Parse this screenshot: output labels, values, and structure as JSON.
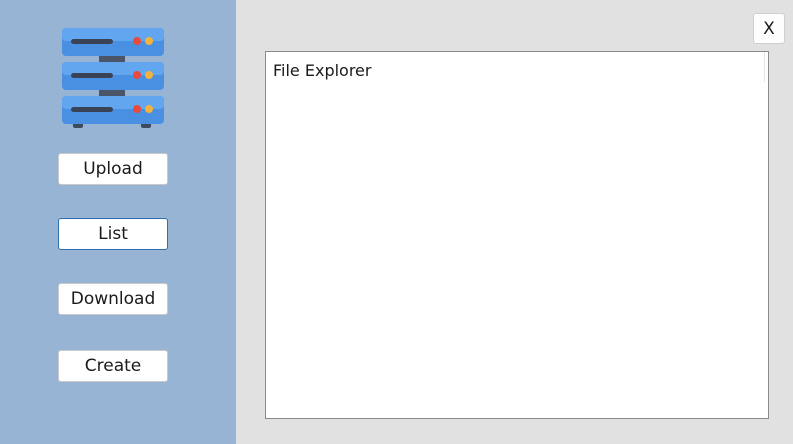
{
  "sidebar": {
    "logo_icon": "server-rack-icon",
    "background": "#98b4d4",
    "buttons": {
      "upload": "Upload",
      "list": "List",
      "download": "Download",
      "create": "Create"
    }
  },
  "window": {
    "close_label": "X"
  },
  "explorer": {
    "title": "File Explorer"
  }
}
